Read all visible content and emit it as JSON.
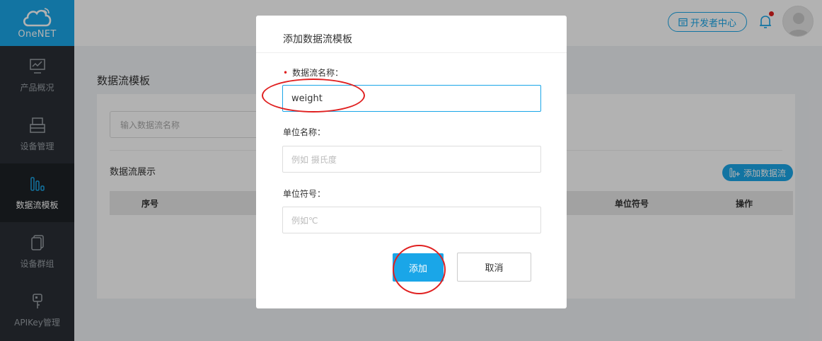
{
  "brand": {
    "name": "OneNET"
  },
  "sidebar": {
    "items": [
      {
        "label": "产品概况",
        "icon": "chart-monitor-icon"
      },
      {
        "label": "设备管理",
        "icon": "device-icon"
      },
      {
        "label": "数据流模板",
        "icon": "datastream-icon",
        "active": true
      },
      {
        "label": "设备群组",
        "icon": "group-icon"
      },
      {
        "label": "APIKey管理",
        "icon": "key-icon"
      }
    ]
  },
  "header": {
    "dev_center": "开发者中心"
  },
  "page": {
    "title": "数据流模板",
    "search_placeholder": "输入数据流名称",
    "section_title": "数据流展示",
    "add_stream_button": "添加数据流",
    "table_headers": {
      "no": "序号",
      "unit_symbol": "单位符号",
      "actions": "操作"
    }
  },
  "modal": {
    "title": "添加数据流模板",
    "name_label": "数据流名称：",
    "name_value": "weight",
    "unit_name_label": "单位名称：",
    "unit_name_placeholder": "例如 摄氏度",
    "unit_symbol_label": "单位符号：",
    "unit_symbol_placeholder": "例如℃",
    "add_button": "添加",
    "cancel_button": "取消"
  },
  "colors": {
    "accent": "#1aa6e8",
    "sidebar": "#2a2f35",
    "annotation": "#e02020"
  }
}
